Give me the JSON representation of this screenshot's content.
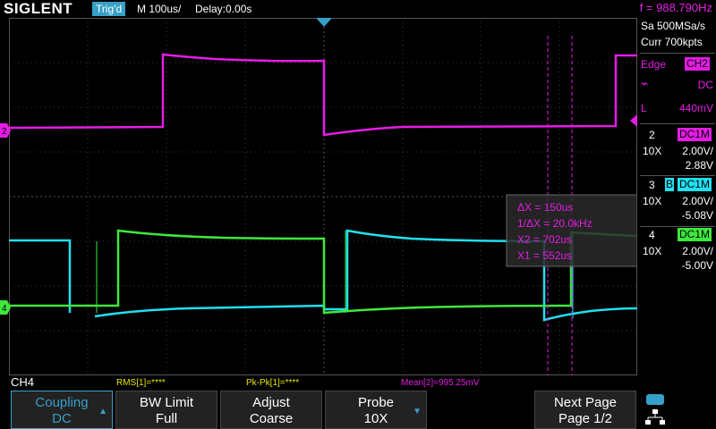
{
  "header": {
    "logo": "SIGLENT",
    "trigger_state": "Trig'd",
    "timebase": "M 100us/",
    "delay": "Delay:0.00s",
    "frequency": "f = 988.790Hz"
  },
  "acquisition": {
    "sample_rate": "Sa 500MSa/s",
    "memory": "Curr 700kpts"
  },
  "trigger": {
    "type": "Edge",
    "source": "CH2",
    "coupling": "DC",
    "level_label": "L",
    "level": "440mV"
  },
  "channels": [
    {
      "num": "2",
      "coupling": "DC1M",
      "probe": "10X",
      "scale": "2.00V/",
      "offset": "2.88V",
      "color": "#e51ce5"
    },
    {
      "num": "3",
      "bw": "B",
      "coupling": "DC1M",
      "probe": "10X",
      "scale": "2.00V/",
      "offset": "-5.08V",
      "color": "#20e0f0"
    },
    {
      "num": "4",
      "coupling": "DC1M",
      "probe": "10X",
      "scale": "2.00V/",
      "offset": "-5.00V",
      "color": "#3ee83e"
    }
  ],
  "markers": {
    "ch2": "2",
    "ch4": "4"
  },
  "cursors": {
    "dx": "ΔX = 150us",
    "inv_dx": "1/ΔX = 20.0kHz",
    "x2": "X2 = 702us",
    "x1": "X1 = 552us"
  },
  "measurements": {
    "channel_label": "CH4",
    "rms": "RMS[1]=****",
    "pkpk": "Pk-Pk[1]=****",
    "mean": "Mean[2]=995.25mV"
  },
  "menu": [
    {
      "top": "Coupling",
      "bottom": "DC"
    },
    {
      "top": "BW Limit",
      "bottom": "Full"
    },
    {
      "top": "Adjust",
      "bottom": "Coarse"
    },
    {
      "top": "Probe",
      "bottom": "10X"
    },
    {
      "top": "Next Page",
      "bottom": "Page 1/2"
    }
  ],
  "colors": {
    "ch2": "#e51ce5",
    "ch3": "#20e0f0",
    "ch4": "#3ee83e",
    "trig_bg": "#36a0c8",
    "measure_yellow": "#e6e600"
  }
}
